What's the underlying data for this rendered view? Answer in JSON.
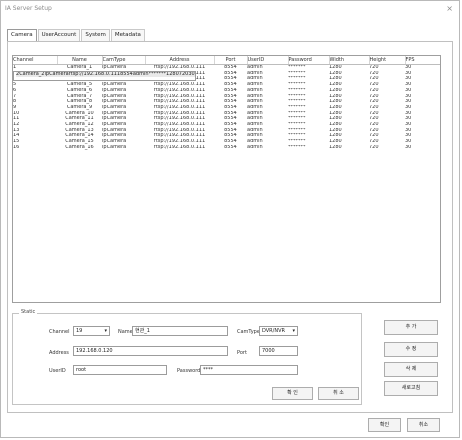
{
  "window": {
    "title": "IA Server Setup",
    "close_label": "×"
  },
  "tabs": [
    {
      "label": "Camera"
    },
    {
      "label": "UserAccount"
    },
    {
      "label": "System"
    },
    {
      "label": "Metadata"
    }
  ],
  "table": {
    "headers": [
      "Channel",
      "Name",
      "CamType",
      "Address",
      "Port",
      "UserID",
      "Password",
      "Width",
      "Height",
      "FPS"
    ],
    "rows": [
      [
        "1",
        "Camera_1",
        "ipCamera",
        "rtsp://192.168.0.111",
        "8554",
        "admin",
        "*******",
        "1280",
        "720",
        "30"
      ],
      [
        "2",
        "Camera_2",
        "ipCamera",
        "rtsp://192.168.0.111",
        "8554",
        "admin",
        "*******",
        "1280",
        "720",
        "30"
      ],
      [
        "3",
        "Camera_3",
        "ipCamera",
        "rtsp://192.168.0.111",
        "8554",
        "admin",
        "*******",
        "1280",
        "720",
        "30"
      ],
      [
        "4",
        "Camera_4",
        "ipCamera",
        "rtsp://192.168.0.111",
        "8554",
        "admin",
        "*******",
        "1280",
        "720",
        "30"
      ],
      [
        "5",
        "Camera_5",
        "ipCamera",
        "rtsp://192.168.0.111",
        "8554",
        "admin",
        "*******",
        "1280",
        "720",
        "30"
      ],
      [
        "6",
        "Camera_6",
        "ipCamera",
        "rtsp://192.168.0.111",
        "8554",
        "admin",
        "*******",
        "1280",
        "720",
        "30"
      ],
      [
        "7",
        "Camera_7",
        "ipCamera",
        "rtsp://192.168.0.111",
        "8554",
        "admin",
        "*******",
        "1280",
        "720",
        "30"
      ],
      [
        "8",
        "Camera_8",
        "ipCamera",
        "rtsp://192.168.0.111",
        "8554",
        "admin",
        "*******",
        "1280",
        "720",
        "30"
      ],
      [
        "9",
        "Camera_9",
        "ipCamera",
        "rtsp://192.168.0.111",
        "8554",
        "admin",
        "*******",
        "1280",
        "720",
        "30"
      ],
      [
        "10",
        "Camera_10",
        "ipCamera",
        "rtsp://192.168.0.111",
        "8554",
        "admin",
        "*******",
        "1280",
        "720",
        "30"
      ],
      [
        "11",
        "Camera_11",
        "ipCamera",
        "rtsp://192.168.0.111",
        "8554",
        "admin",
        "*******",
        "1280",
        "720",
        "30"
      ],
      [
        "12",
        "Camera_12",
        "ipCamera",
        "rtsp://192.168.0.111",
        "8554",
        "admin",
        "*******",
        "1280",
        "720",
        "30"
      ],
      [
        "13",
        "Camera_13",
        "ipCamera",
        "rtsp://192.168.0.111",
        "8554",
        "admin",
        "*******",
        "1280",
        "720",
        "30"
      ],
      [
        "14",
        "Camera_14",
        "ipCamera",
        "rtsp://192.168.0.111",
        "8554",
        "admin",
        "*******",
        "1280",
        "720",
        "30"
      ],
      [
        "15",
        "Camera_15",
        "ipCamera",
        "rtsp://192.168.0.111",
        "8554",
        "admin",
        "*******",
        "1280",
        "720",
        "30"
      ],
      [
        "16",
        "Camera_16",
        "ipCamera",
        "rtsp://192.168.0.111",
        "8554",
        "admin",
        "*******",
        "1280",
        "720",
        "30"
      ]
    ],
    "selected_row": 1
  },
  "form": {
    "group_label": "Static",
    "channel_label": "Channel",
    "channel_value": "19",
    "name_label": "Name",
    "name_value": "현관_1",
    "camtype_label": "CamType",
    "camtype_value": "DVR/NVR",
    "address_label": "Address",
    "address_value": "192.168.0.120",
    "port_label": "Port",
    "port_value": "7000",
    "userid_label": "UserID",
    "userid_value": "root",
    "password_label": "Password",
    "password_value": "****",
    "ok_label": "확 인",
    "cancel_label": "취 소"
  },
  "side_buttons": {
    "add": "추 가",
    "edit": "수 정",
    "delete": "삭 제",
    "refresh": "새로고침"
  },
  "footer": {
    "ok": "확인",
    "cancel": "취소"
  },
  "icons": {
    "dropdown": "chevron-down-icon"
  }
}
